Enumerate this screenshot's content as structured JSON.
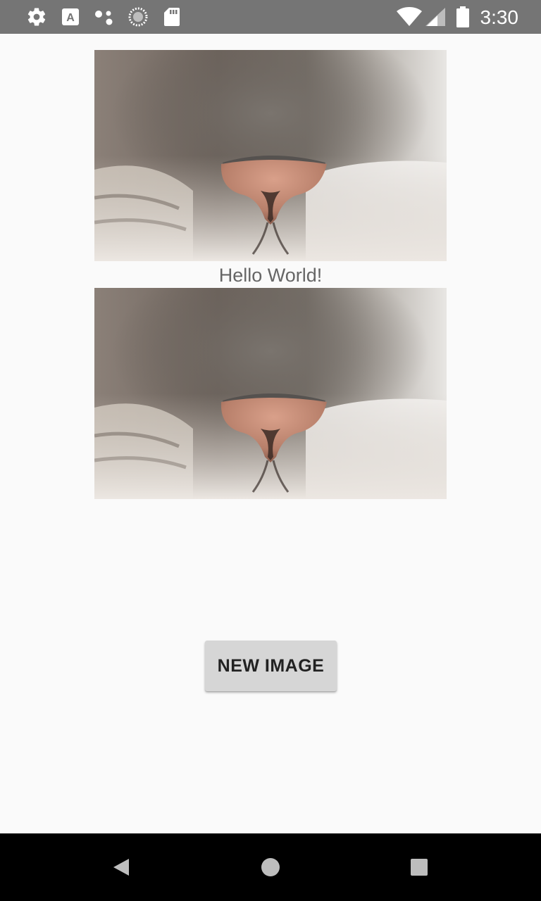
{
  "status_bar": {
    "time": "3:30",
    "icons": [
      "settings-icon",
      "keyboard-a-icon",
      "assistant-dots-icon",
      "sync-circle-icon",
      "sd-card-icon",
      "wifi-icon",
      "signal-icon",
      "battery-icon"
    ]
  },
  "content": {
    "greeting": "Hello World!",
    "new_image_button": "NEW IMAGE"
  },
  "nav_bar": {
    "icons": [
      "back-icon",
      "home-icon",
      "recents-icon"
    ]
  },
  "colors": {
    "status_bar": "#757575",
    "background": "#fafafa",
    "button": "#d6d6d6",
    "nav_bar": "#000000",
    "greeting_text": "#666666"
  }
}
